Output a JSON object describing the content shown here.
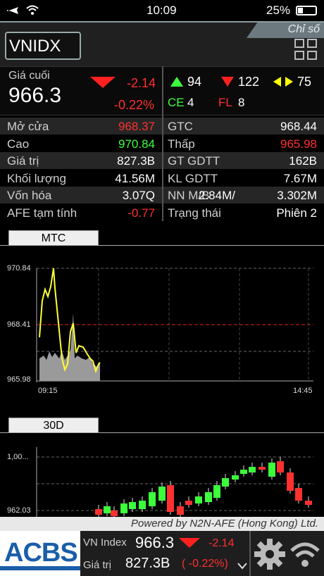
{
  "status_bar": {
    "time": "10:09",
    "battery": "25%"
  },
  "header": {
    "tab_label": "Chỉ số",
    "symbol": "VNIDX"
  },
  "summary": {
    "last_label": "Giá cuối",
    "last_value": "966.3",
    "change": "-2.14",
    "change_pct": "-0.22%",
    "up_count": "94",
    "down_count": "122",
    "flat_count": "75",
    "ce_label": "CE",
    "ce_count": "4",
    "fl_label": "FL",
    "fl_count": "8"
  },
  "rows": [
    {
      "l1": "Mở cửa",
      "v1": "968.37",
      "c1": "red",
      "l2": "GTC",
      "v2": "968.44",
      "c2": "white"
    },
    {
      "l1": "Cao",
      "v1": "970.84",
      "c1": "green",
      "l2": "Thấp",
      "v2": "965.98",
      "c2": "red"
    },
    {
      "l1": "Giá trị",
      "v1": "827.3B",
      "c1": "white",
      "l2": "GT GDTT",
      "v2": "162B",
      "c2": "white"
    },
    {
      "l1": "Khối lượng",
      "v1": "41.56M",
      "c1": "white",
      "l2": "KL GDTT",
      "v2": "7.67M",
      "c2": "white"
    },
    {
      "l1": "Vốn hóa",
      "v1": "3.07Q",
      "c1": "white",
      "l2": "NN M/B",
      "v2": "3.302M",
      "c2": "white",
      "overlap": "2.84M/"
    },
    {
      "l1": "AFE tạm tính",
      "v1": "-0.77",
      "c1": "red",
      "l2": "Trạng thái",
      "v2": "Phiên 2",
      "c2": "white"
    }
  ],
  "intraday": {
    "tab_label": "MTC",
    "y_labels": [
      "970.84",
      "968.41",
      "965.98"
    ],
    "x_labels": [
      "09:15",
      "14:45"
    ]
  },
  "daily": {
    "tab_label": "30D",
    "y_labels": [
      "1,00...",
      "962.03"
    ]
  },
  "footer": {
    "powered": "Powered by N2N-AFE (Hong Kong) Ltd.",
    "logo": "ACBS",
    "index_label": "VN Index",
    "index_value": "966.3",
    "index_change": "-2.14",
    "value_label": "Giá trị",
    "value_value": "827.3B",
    "value_pct": "( -0.22%)"
  },
  "colors": {
    "up": "#3cff3c",
    "down": "#ff3030",
    "flat": "#ffff00",
    "line": "#ffff33"
  }
}
